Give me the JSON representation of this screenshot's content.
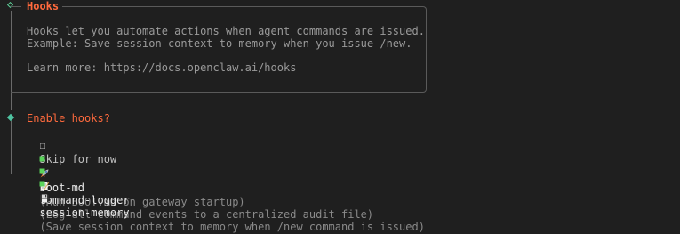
{
  "hooks_panel": {
    "title": "Hooks",
    "line1": "Hooks let you automate actions when agent commands are issued.",
    "line2": "Example: Save session context to memory when you issue /new.",
    "line3": "Learn more: https://docs.openclaw.ai/hooks"
  },
  "prompt": {
    "question": "Enable hooks?",
    "options": [
      {
        "checkbox": "☐",
        "label": "Skip for now",
        "selected": false
      },
      {
        "checkbox": "■",
        "icon": "rocket-icon",
        "name": "boot-md",
        "description": "(Run BOOT.md on gateway startup)",
        "selected": true
      },
      {
        "checkbox": "■",
        "icon": "memo-icon",
        "name": "command-logger",
        "description": "(Log all command events to a centralized audit file)",
        "selected": true
      },
      {
        "checkbox": "■",
        "icon": "floppy-disk-icon",
        "name": "session-memory",
        "description": "(Save session context to memory when /new command is issued)",
        "selected": true
      }
    ]
  },
  "colors": {
    "accent": "#ff6a3d",
    "check": "#5bd45b",
    "diamond": "#4fc3a1",
    "background": "#1f1f1f"
  }
}
